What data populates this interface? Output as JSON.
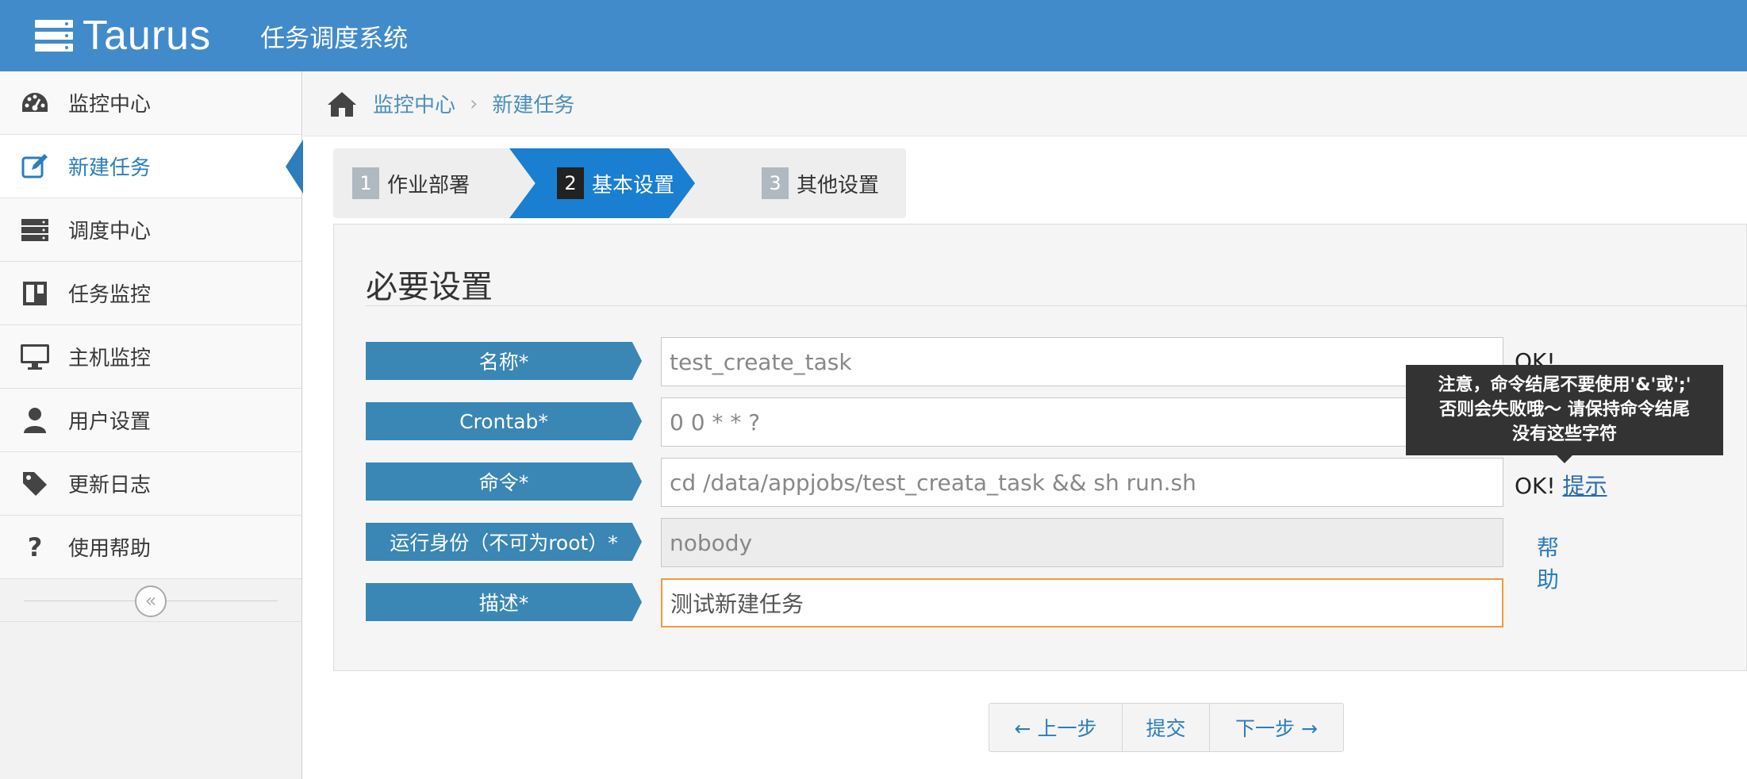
{
  "navbar": {
    "brand": "Taurus",
    "subtitle": "任务调度系统"
  },
  "sidebar": {
    "items": [
      {
        "label": "监控中心",
        "icon": "dashboard-icon"
      },
      {
        "label": "新建任务",
        "icon": "edit-icon",
        "active": true
      },
      {
        "label": "调度中心",
        "icon": "server-icon"
      },
      {
        "label": "任务监控",
        "icon": "panels-icon"
      },
      {
        "label": "主机监控",
        "icon": "desktop-icon"
      },
      {
        "label": "用户设置",
        "icon": "user-icon"
      },
      {
        "label": "更新日志",
        "icon": "tag-icon"
      },
      {
        "label": "使用帮助",
        "icon": "question-icon"
      }
    ],
    "collapse_glyph": "«"
  },
  "breadcrumb": {
    "home": "监控中心",
    "current": "新建任务",
    "separator": "›"
  },
  "wizard": {
    "steps": [
      {
        "num": "1",
        "label": "作业部署"
      },
      {
        "num": "2",
        "label": "基本设置",
        "active": true
      },
      {
        "num": "3",
        "label": "其他设置"
      }
    ]
  },
  "form": {
    "title": "必要设置",
    "fields": {
      "name": {
        "label": "名称*",
        "value": "test_create_task",
        "status": "OK!"
      },
      "crontab": {
        "label": "Crontab*",
        "value": "0 0 * * ?"
      },
      "command": {
        "label": "命令*",
        "value": "cd /data/appjobs/test_creata_task && sh run.sh",
        "status": "OK!",
        "hint_link": "提示"
      },
      "run_as": {
        "label": "运行身份（不可为root）*",
        "value": "nobody",
        "help_link": "帮助"
      },
      "description": {
        "label": "描述*",
        "value": "测试新建任务"
      }
    }
  },
  "tooltip": {
    "line1": "注意，命令结尾不要使用'&'或';'",
    "line2": "否则会失败哦～ 请保持命令结尾",
    "line3": "没有这些字符"
  },
  "buttons": {
    "prev": "← 上一步",
    "submit": "提交",
    "next": "下一步 →"
  },
  "colors": {
    "navbar": "#428bca",
    "accent": "#2b7dbc",
    "tag": "#3a87b5",
    "active_step": "#1a7fd0",
    "focus_border": "#f09a3e"
  }
}
